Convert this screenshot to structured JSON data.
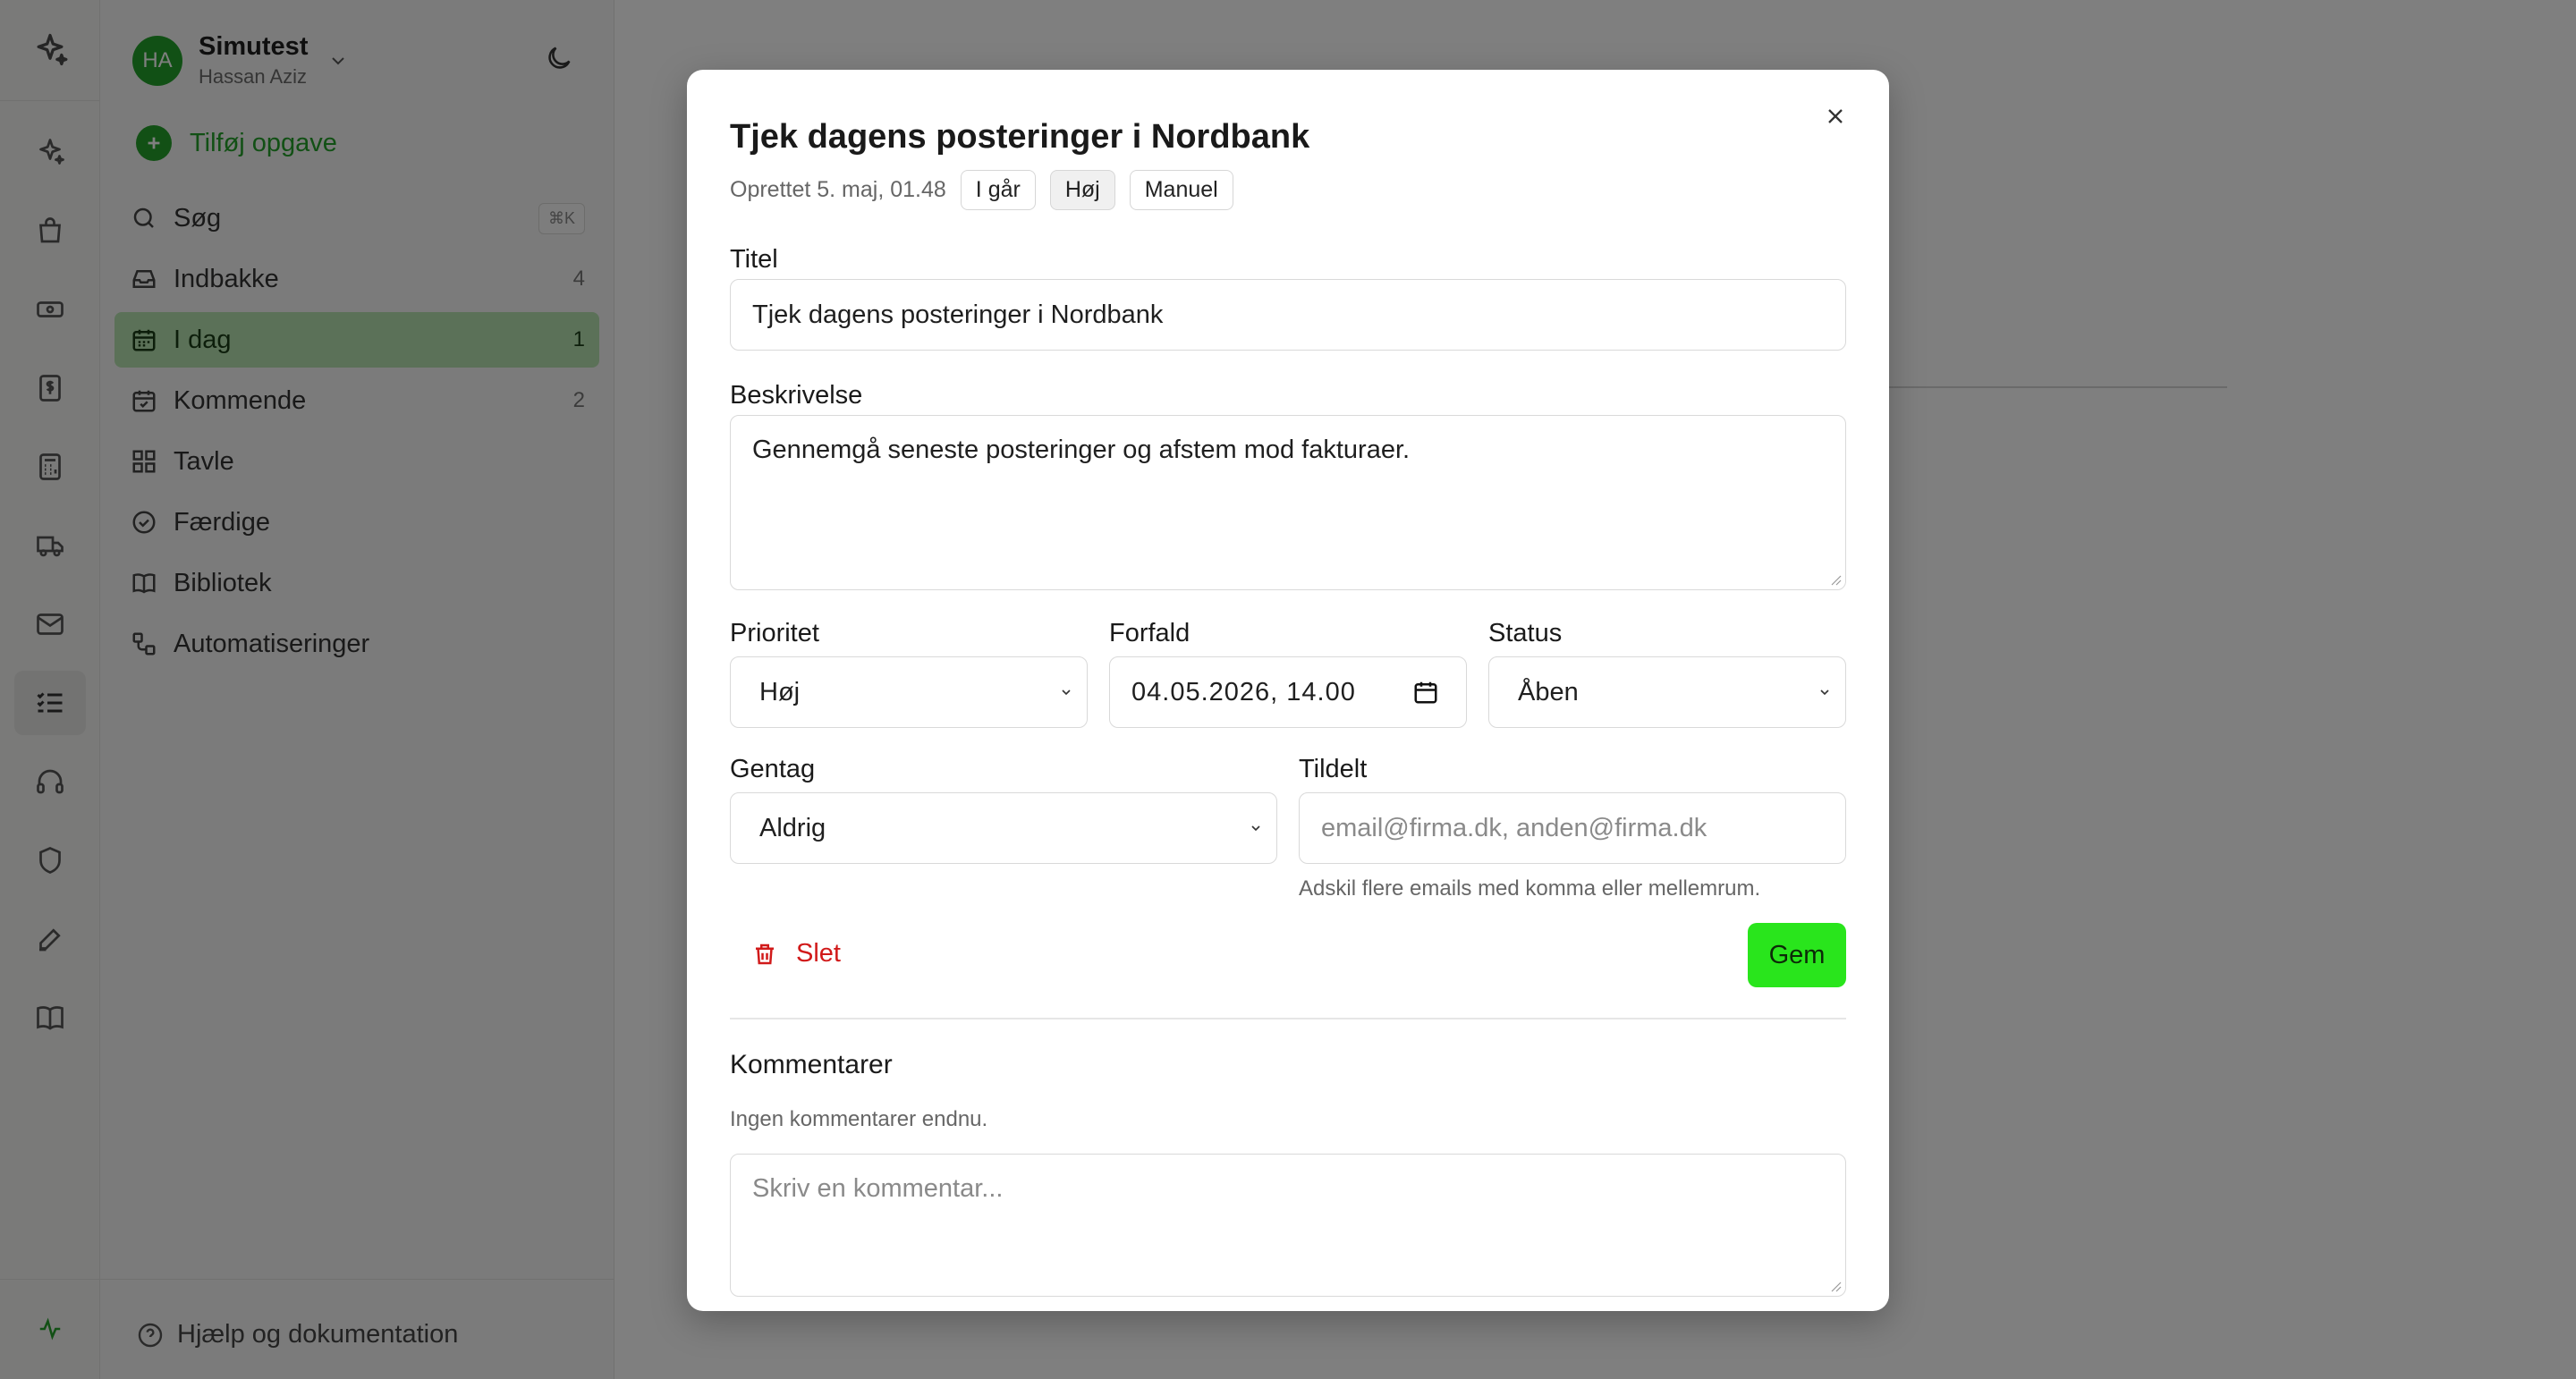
{
  "account": {
    "initials": "HA",
    "name": "Simutest",
    "user": "Hassan Aziz"
  },
  "sidebar": {
    "add_task": "Tilføj opgave",
    "search_label": "Søg",
    "search_shortcut": "⌘K",
    "items": [
      {
        "label": "Indbakke",
        "count": "4",
        "icon": "inbox-icon"
      },
      {
        "label": "I dag",
        "count": "1",
        "icon": "calendar-today-icon",
        "active": true
      },
      {
        "label": "Kommende",
        "count": "2",
        "icon": "calendar-check-icon"
      },
      {
        "label": "Tavle",
        "count": "",
        "icon": "grid-icon"
      },
      {
        "label": "Færdige",
        "count": "",
        "icon": "check-circle-icon"
      },
      {
        "label": "Bibliotek",
        "count": "",
        "icon": "book-open-icon"
      },
      {
        "label": "Automatiseringer",
        "count": "",
        "icon": "workflow-icon"
      }
    ],
    "help": "Hjælp og dokumentation"
  },
  "rail": {
    "icons": [
      "sparkles-icon",
      "shopping-bag-icon",
      "banknote-icon",
      "receipt-dollar-icon",
      "calculator-icon",
      "truck-icon",
      "mail-icon",
      "tasks-icon",
      "headset-icon",
      "shield-icon",
      "pen-icon",
      "book-icon"
    ],
    "active": "tasks-icon",
    "bottom_icon": "activity-icon"
  },
  "modal": {
    "title": "Tjek dagens posteringer i Nordbank",
    "created": "Oprettet 5. maj, 01.48",
    "chips": [
      "I går",
      "Høj",
      "Manuel"
    ],
    "fields": {
      "title_label": "Titel",
      "title_value": "Tjek dagens posteringer i Nordbank",
      "description_label": "Beskrivelse",
      "description_value": "Gennemgå seneste posteringer og afstem mod fakturaer.",
      "priority_label": "Prioritet",
      "priority_value": "Høj",
      "due_label": "Forfald",
      "due_value": "04.05.2026, 14.00",
      "status_label": "Status",
      "status_value": "Åben",
      "repeat_label": "Gentag",
      "repeat_value": "Aldrig",
      "assigned_label": "Tildelt",
      "assigned_placeholder": "email@firma.dk, anden@firma.dk",
      "assigned_hint": "Adskil flere emails med komma eller mellemrum."
    },
    "delete_label": "Slet",
    "save_label": "Gem",
    "comments": {
      "heading": "Kommentarer",
      "empty": "Ingen kommentarer endnu.",
      "placeholder": "Skriv en kommentar..."
    }
  },
  "colors": {
    "accent_green": "#24a02b",
    "save_green": "#29e51c",
    "active_nav": "#b7e2b0",
    "danger": "#d11a1a"
  }
}
